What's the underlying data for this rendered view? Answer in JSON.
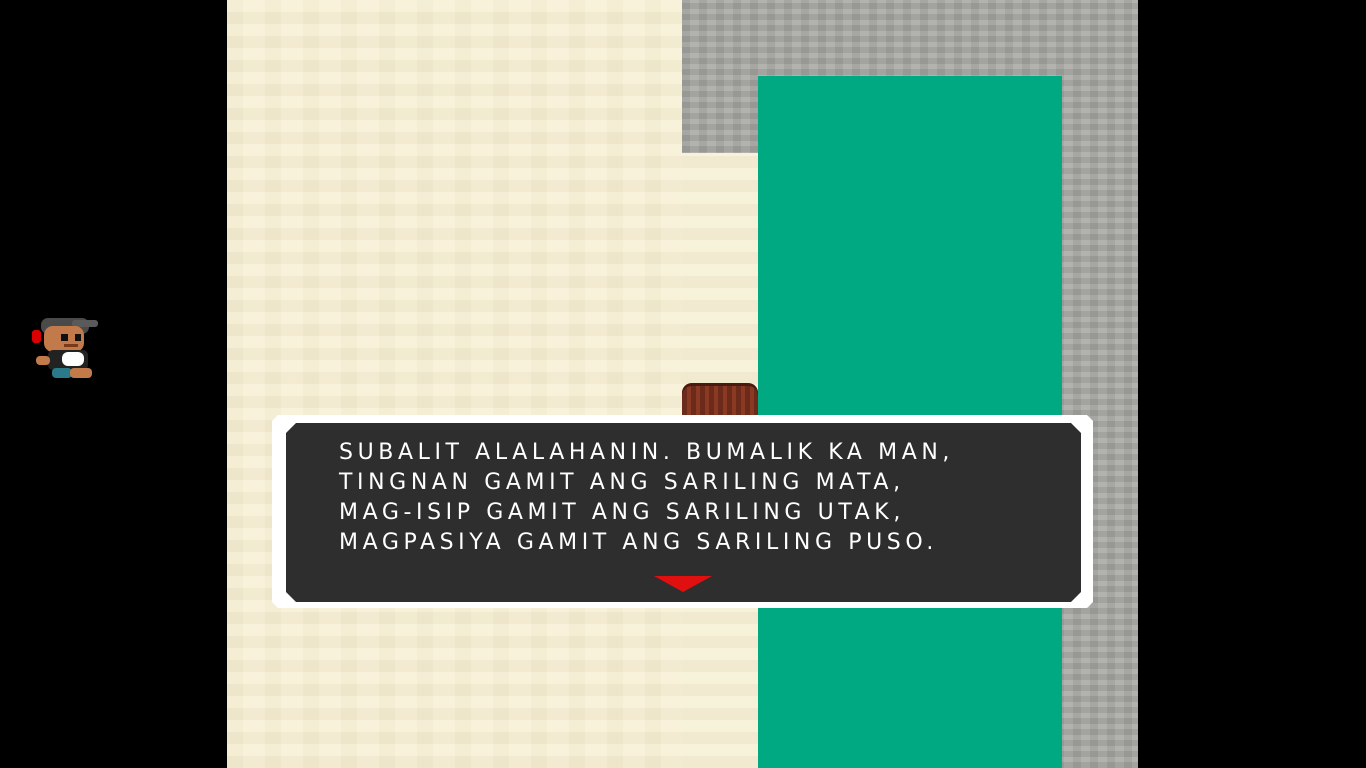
{
  "dialog": {
    "lines": [
      "SUBALIT ALALAHANIN. BUMALIK KA MAN,",
      "TINGNAN GAMIT ANG SARILING MATA,",
      "MAG-ISIP GAMIT ANG SARILING UTAK,",
      "MAGPASIYA GAMIT ANG SARILING PUSO."
    ],
    "advance_indicator": "down-triangle-icon"
  },
  "scene": {
    "sand_color": "#f6f0d8",
    "stone_color": "#a9a9a5",
    "water_color": "#00a981",
    "dialog_bg": "#2e2e2e",
    "dialog_border": "#ffffff",
    "arrow_color": "#e01010",
    "portrait": "boy-character-icon"
  }
}
